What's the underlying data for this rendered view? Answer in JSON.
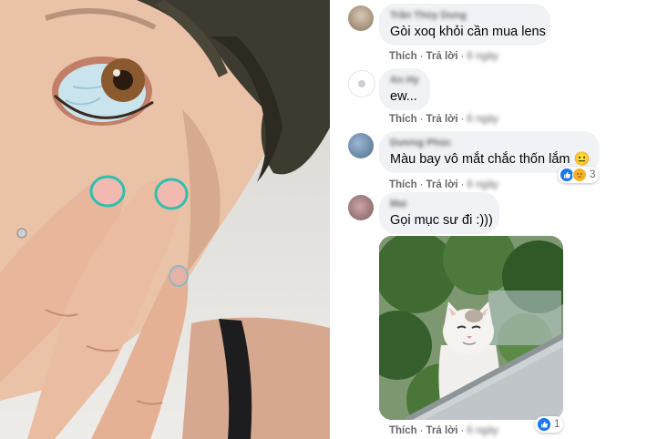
{
  "comments": [
    {
      "author": "Trần Thùy Dung",
      "text": "Gòi xoq khỏi cần mua lens",
      "actions": {
        "like": "Thích",
        "reply": "Trả lời",
        "time": "6 ngày"
      }
    },
    {
      "author": "An Hy",
      "text": "ew...",
      "actions": {
        "like": "Thích",
        "reply": "Trả lời",
        "time": "6 ngày"
      }
    },
    {
      "author": "Dương Phúc",
      "text": "Màu bay vô mắt chắc thốn lắm 😐",
      "actions": {
        "like": "Thích",
        "reply": "Trả lời",
        "time": "6 ngày"
      },
      "reactions": {
        "icons": [
          "like-icon",
          "sad-icon"
        ],
        "count": "3"
      }
    },
    {
      "author": "Mai",
      "text": "Gọi mục sư đi :)))",
      "image": "cat-photo",
      "actions": {
        "like": "Thích",
        "reply": "Trả lời",
        "time": "6 ngày"
      },
      "reactions": {
        "icons": [
          "like-icon"
        ],
        "count": "1"
      }
    }
  ],
  "colors": {
    "bubble": "#f0f2f5",
    "like": "#1877f2",
    "meta": "#65676b",
    "text": "#050505"
  }
}
